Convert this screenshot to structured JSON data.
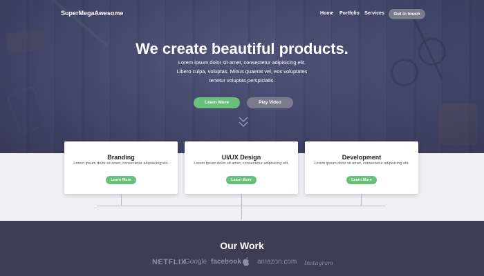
{
  "navbar": {
    "brand": "SuperMegaAwesome",
    "links": [
      "Home",
      "Portfolio",
      "Services"
    ],
    "cta": "Get in touch"
  },
  "hero": {
    "headline": "We create beautiful products.",
    "subtext": "Lorem ipsum dolor sit amet, consectetur adipisicing elit. Libero culpa, voluptas. Minus quaerat vel, eos voluptates tenetur voluptas perspiciatis.",
    "primary_button": "Learn More",
    "secondary_button": "Play Video",
    "scroll_icon": "double-chevron-down-icon"
  },
  "services": [
    {
      "title": "Branding",
      "description": "Lorem ipsum dolor sit amet, consectetur adipisicing elit.",
      "button": "Learn More"
    },
    {
      "title": "UI/UX Design",
      "description": "Lorem ipsum dolor sit amet, consectetur adipisicing elit.",
      "button": "Learn More"
    },
    {
      "title": "Development",
      "description": "Lorem ipsum dolor sit amet, consectetur adipisicing elit.",
      "button": "Learn More"
    }
  ],
  "work": {
    "title": "Our Work",
    "logos": [
      "NETFLIX",
      "Google",
      "facebook",
      "apple-icon",
      "amazon.com",
      "Instagram"
    ]
  },
  "colors": {
    "accent_green": "#6abf7b",
    "muted_button": "#7a7b8f",
    "dark_section": "#3f3d56",
    "hero_overlay": "#4a4f72",
    "light_strip": "#f0f0f4"
  }
}
